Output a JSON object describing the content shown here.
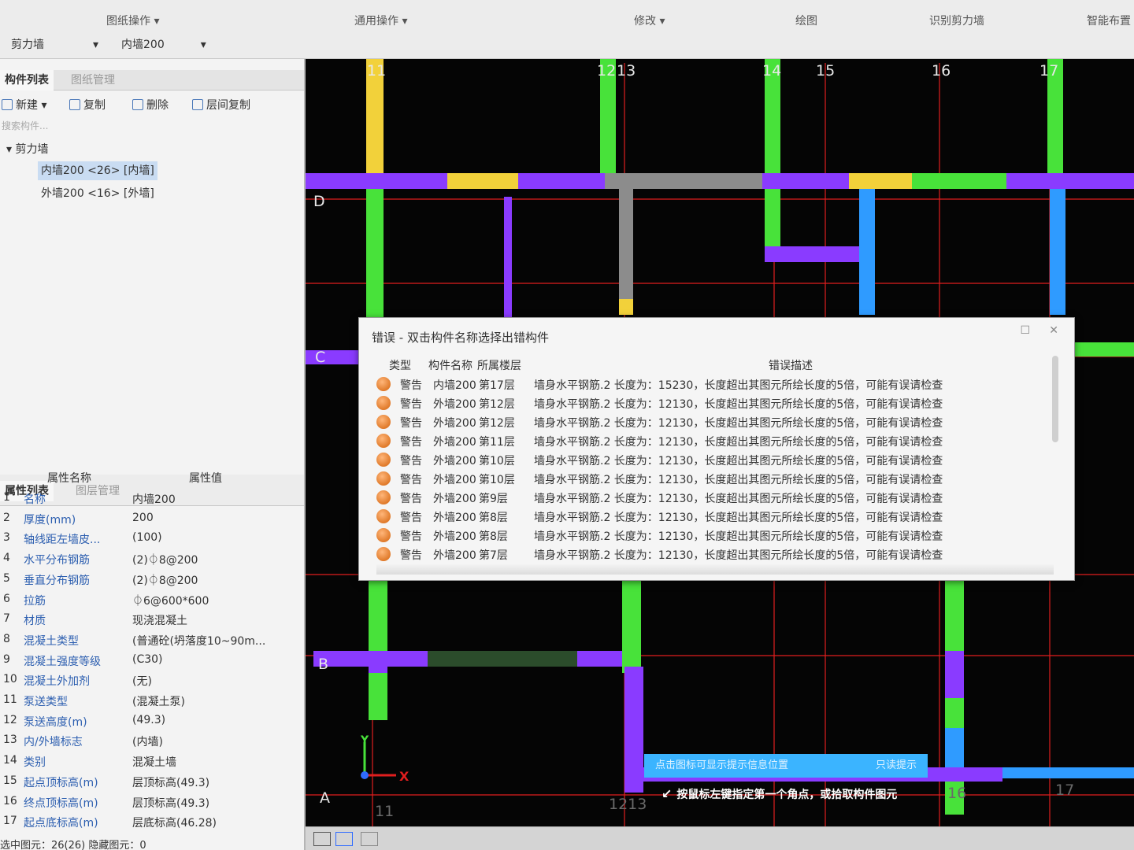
{
  "ribbon": {
    "groups": [
      "图纸操作 ▾",
      "通用操作 ▾",
      "修改 ▾",
      "绘图",
      "识别剪力墙",
      "智能布置"
    ],
    "selectors": [
      "剪力墙",
      "内墙200"
    ]
  },
  "left_panel": {
    "tabs": [
      "构件列表",
      "图纸管理"
    ],
    "toolbar": [
      "新建 ▾",
      "复制",
      "删除",
      "层间复制"
    ],
    "search_placeholder": "搜索构件...",
    "tree_root": "▾ 剪力墙",
    "tree_items": [
      "内墙200 <26> [内墙]",
      "外墙200 <16> [外墙]"
    ],
    "prop_tabs": [
      "属性列表",
      "图层管理"
    ],
    "prop_cols": [
      "属性名称",
      "属性值"
    ],
    "properties": [
      {
        "no": "1",
        "name": "名称",
        "value": "内墙200"
      },
      {
        "no": "2",
        "name": "厚度(mm)",
        "value": "200"
      },
      {
        "no": "3",
        "name": "轴线距左墙皮...",
        "value": "(100)"
      },
      {
        "no": "4",
        "name": "水平分布钢筋",
        "value": "(2)⏀8@200"
      },
      {
        "no": "5",
        "name": "垂直分布钢筋",
        "value": "(2)⏀8@200"
      },
      {
        "no": "6",
        "name": "拉筋",
        "value": "⏀6@600*600"
      },
      {
        "no": "7",
        "name": "材质",
        "value": "现浇混凝土"
      },
      {
        "no": "8",
        "name": "混凝土类型",
        "value": "(普通砼(坍落度10~90m..."
      },
      {
        "no": "9",
        "name": "混凝土强度等级",
        "value": "(C30)"
      },
      {
        "no": "10",
        "name": "混凝土外加剂",
        "value": "(无)"
      },
      {
        "no": "11",
        "name": "泵送类型",
        "value": "(混凝土泵)"
      },
      {
        "no": "12",
        "name": "泵送高度(m)",
        "value": "(49.3)"
      },
      {
        "no": "13",
        "name": "内/外墙标志",
        "value": "(内墙)"
      },
      {
        "no": "14",
        "name": "类别",
        "value": "混凝土墙"
      },
      {
        "no": "15",
        "name": "起点顶标高(m)",
        "value": "层顶标高(49.3)"
      },
      {
        "no": "16",
        "name": "终点顶标高(m)",
        "value": "层顶标高(49.3)"
      },
      {
        "no": "17",
        "name": "起点底标高(m)",
        "value": "层底标高(46.28)"
      }
    ],
    "status": "选中图元：26(26)    隐藏图元：0"
  },
  "canvas": {
    "axis_top": [
      "11",
      "12",
      "13",
      "14",
      "15",
      "16",
      "17"
    ],
    "axis_left": [
      "D",
      "C",
      "B",
      "A"
    ],
    "axis_bottom": [
      "11",
      "1213",
      "16",
      "17"
    ],
    "hint_bar": "点击图标可显示提示信息位置",
    "hint_bar_right": "只读提示",
    "cmd_hint": "按鼠标左键指定第一个角点，或拾取构件图元",
    "ucs_x": "X",
    "ucs_y": "Y",
    "colors": {
      "purple": "#8a3bff",
      "green": "#48e23a",
      "yellow": "#f2d13a",
      "blue": "#2f9bff",
      "gray": "#8c8c8c",
      "grid": "#e01e1e"
    }
  },
  "dialog": {
    "title": "错误 - 双击构件名称选择出错构件",
    "columns": [
      "类型",
      "构件名称",
      "所属楼层",
      "错误描述"
    ],
    "rows": [
      {
        "type": "警告",
        "name": "内墙200",
        "floor": "第17层",
        "desc": "墙身水平钢筋.2 长度为：15230，长度超出其图元所绘长度的5倍，可能有误请检查"
      },
      {
        "type": "警告",
        "name": "外墙200",
        "floor": "第12层",
        "desc": "墙身水平钢筋.2 长度为：12130，长度超出其图元所绘长度的5倍，可能有误请检查"
      },
      {
        "type": "警告",
        "name": "外墙200",
        "floor": "第12层",
        "desc": "墙身水平钢筋.2 长度为：12130，长度超出其图元所绘长度的5倍，可能有误请检查"
      },
      {
        "type": "警告",
        "name": "外墙200",
        "floor": "第11层",
        "desc": "墙身水平钢筋.2 长度为：12130，长度超出其图元所绘长度的5倍，可能有误请检查"
      },
      {
        "type": "警告",
        "name": "外墙200",
        "floor": "第10层",
        "desc": "墙身水平钢筋.2 长度为：12130，长度超出其图元所绘长度的5倍，可能有误请检查"
      },
      {
        "type": "警告",
        "name": "外墙200",
        "floor": "第10层",
        "desc": "墙身水平钢筋.2 长度为：12130，长度超出其图元所绘长度的5倍，可能有误请检查"
      },
      {
        "type": "警告",
        "name": "外墙200",
        "floor": "第9层",
        "desc": "墙身水平钢筋.2 长度为：12130，长度超出其图元所绘长度的5倍，可能有误请检查"
      },
      {
        "type": "警告",
        "name": "外墙200",
        "floor": "第8层",
        "desc": "墙身水平钢筋.2 长度为：12130，长度超出其图元所绘长度的5倍，可能有误请检查"
      },
      {
        "type": "警告",
        "name": "外墙200",
        "floor": "第8层",
        "desc": "墙身水平钢筋.2 长度为：12130，长度超出其图元所绘长度的5倍，可能有误请检查"
      },
      {
        "type": "警告",
        "name": "外墙200",
        "floor": "第7层",
        "desc": "墙身水平钢筋.2 长度为：12130，长度超出其图元所绘长度的5倍，可能有误请检查"
      }
    ]
  }
}
